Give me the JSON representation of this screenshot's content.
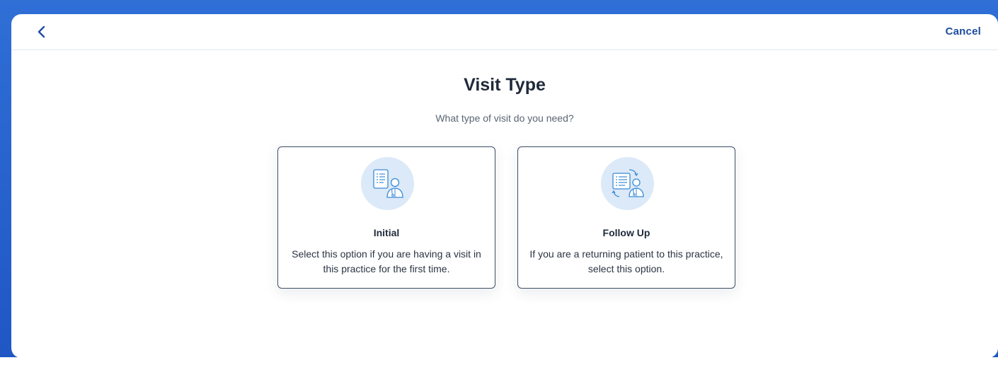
{
  "header": {
    "back_icon": "chevron-left-icon",
    "cancel_label": "Cancel"
  },
  "main": {
    "title": "Visit Type",
    "subtitle": "What type of visit do you need?",
    "options": [
      {
        "title": "Initial",
        "description": "Select this option if you are having a visit in this practice for the first time.",
        "icon": "clipboard-doctor-icon"
      },
      {
        "title": "Follow Up",
        "description": "If you are a returning patient to this practice, select this option.",
        "icon": "document-refresh-doctor-icon"
      }
    ]
  },
  "colors": {
    "brand_blue": "#1e4c9e",
    "backdrop_blue": "#2563d0",
    "icon_circle_bg": "#dbe9f8",
    "card_border": "#3d4e63"
  }
}
